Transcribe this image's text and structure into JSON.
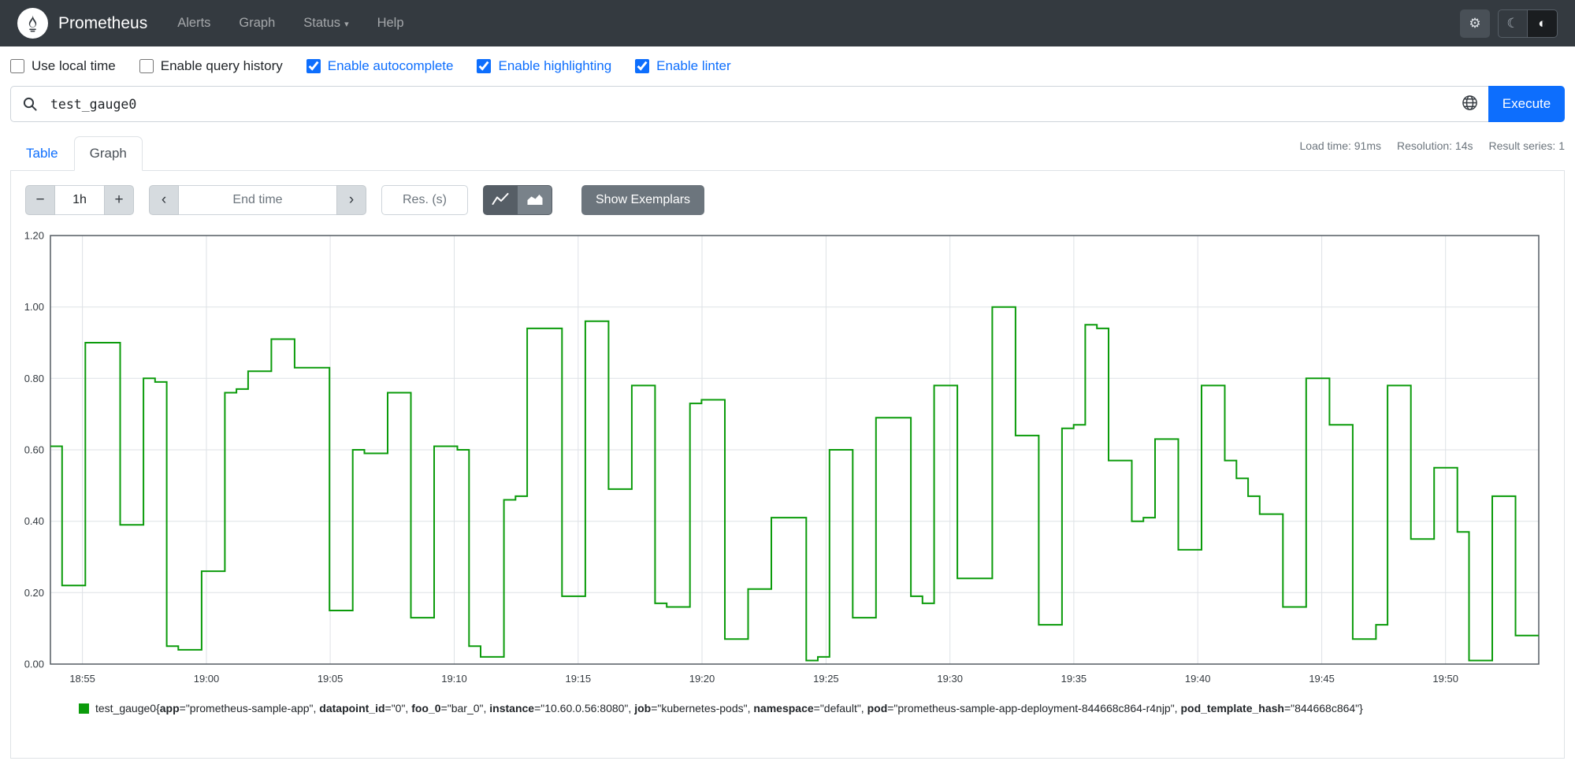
{
  "navbar": {
    "brand": "Prometheus",
    "items": [
      {
        "label": "Alerts"
      },
      {
        "label": "Graph"
      },
      {
        "label": "Status",
        "has_dropdown": true
      },
      {
        "label": "Help"
      }
    ]
  },
  "icons": {
    "minus": "−",
    "plus": "+",
    "prev": "‹",
    "next": "›",
    "caret": "▾",
    "gear": "⚙",
    "moon": "☾",
    "theme_auto": "◐"
  },
  "options": [
    {
      "label": "Use local time",
      "checked": false
    },
    {
      "label": "Enable query history",
      "checked": false
    },
    {
      "label": "Enable autocomplete",
      "checked": true
    },
    {
      "label": "Enable highlighting",
      "checked": true
    },
    {
      "label": "Enable linter",
      "checked": true
    }
  ],
  "query": {
    "value": "test_gauge0",
    "execute_label": "Execute"
  },
  "stats": {
    "load_time": "Load time: 91ms",
    "resolution": "Resolution: 14s",
    "result_series": "Result series: 1"
  },
  "tabs": [
    {
      "label": "Table",
      "active": false
    },
    {
      "label": "Graph",
      "active": true
    }
  ],
  "graph_controls": {
    "range": "1h",
    "end_time_placeholder": "End time",
    "res_placeholder": "Res. (s)",
    "show_exemplars": "Show Exemplars"
  },
  "chart_data": {
    "type": "line",
    "style": "step",
    "title": "",
    "xlabel": "",
    "ylabel": "",
    "ylim": [
      0,
      1.2
    ],
    "grid": true,
    "series_name": "test_gauge0",
    "series_color": "#0b9b0b",
    "y_ticks": [
      0,
      0.2,
      0.4,
      0.6,
      0.8,
      1,
      1.2
    ],
    "x_ticks": [
      {
        "label": "18:55",
        "f": 0.0215
      },
      {
        "label": "19:00",
        "f": 0.1048
      },
      {
        "label": "19:05",
        "f": 0.188
      },
      {
        "label": "19:10",
        "f": 0.2713
      },
      {
        "label": "19:15",
        "f": 0.3546
      },
      {
        "label": "19:20",
        "f": 0.4378
      },
      {
        "label": "19:25",
        "f": 0.5211
      },
      {
        "label": "19:30",
        "f": 0.6044
      },
      {
        "label": "19:35",
        "f": 0.6876
      },
      {
        "label": "19:40",
        "f": 0.7709
      },
      {
        "label": "19:45",
        "f": 0.8542
      },
      {
        "label": "19:50",
        "f": 0.9374
      }
    ],
    "values": [
      0.61,
      0.22,
      0.22,
      0.9,
      0.9,
      0.9,
      0.39,
      0.39,
      0.8,
      0.79,
      0.05,
      0.04,
      0.04,
      0.26,
      0.26,
      0.76,
      0.77,
      0.82,
      0.82,
      0.91,
      0.91,
      0.83,
      0.83,
      0.83,
      0.15,
      0.15,
      0.6,
      0.59,
      0.59,
      0.76,
      0.76,
      0.13,
      0.13,
      0.61,
      0.61,
      0.6,
      0.05,
      0.02,
      0.02,
      0.46,
      0.47,
      0.94,
      0.94,
      0.94,
      0.19,
      0.19,
      0.96,
      0.96,
      0.49,
      0.49,
      0.78,
      0.78,
      0.17,
      0.16,
      0.16,
      0.73,
      0.74,
      0.74,
      0.07,
      0.07,
      0.21,
      0.21,
      0.41,
      0.41,
      0.41,
      0.01,
      0.02,
      0.6,
      0.6,
      0.13,
      0.13,
      0.69,
      0.69,
      0.69,
      0.19,
      0.17,
      0.78,
      0.78,
      0.24,
      0.24,
      0.24,
      1.0,
      1.0,
      0.64,
      0.64,
      0.11,
      0.11,
      0.66,
      0.67,
      0.95,
      0.94,
      0.57,
      0.57,
      0.4,
      0.41,
      0.63,
      0.63,
      0.32,
      0.32,
      0.78,
      0.78,
      0.57,
      0.52,
      0.47,
      0.42,
      0.42,
      0.16,
      0.16,
      0.8,
      0.8,
      0.67,
      0.67,
      0.07,
      0.07,
      0.11,
      0.78,
      0.78,
      0.35,
      0.35,
      0.55,
      0.55,
      0.37,
      0.01,
      0.01,
      0.47,
      0.47,
      0.08,
      0.08
    ]
  },
  "legend": {
    "metric": "test_gauge0",
    "labels": [
      {
        "name": "app",
        "value": "prometheus-sample-app"
      },
      {
        "name": "datapoint_id",
        "value": "0"
      },
      {
        "name": "foo_0",
        "value": "bar_0"
      },
      {
        "name": "instance",
        "value": "10.60.0.56:8080"
      },
      {
        "name": "job",
        "value": "kubernetes-pods"
      },
      {
        "name": "namespace",
        "value": "default"
      },
      {
        "name": "pod",
        "value": "prometheus-sample-app-deployment-844668c864-r4njp"
      },
      {
        "name": "pod_template_hash",
        "value": "844668c864"
      }
    ]
  },
  "colors": {
    "accent": "#0d6efd",
    "navbar_bg": "#343a40",
    "series": "#0b9b0b"
  }
}
